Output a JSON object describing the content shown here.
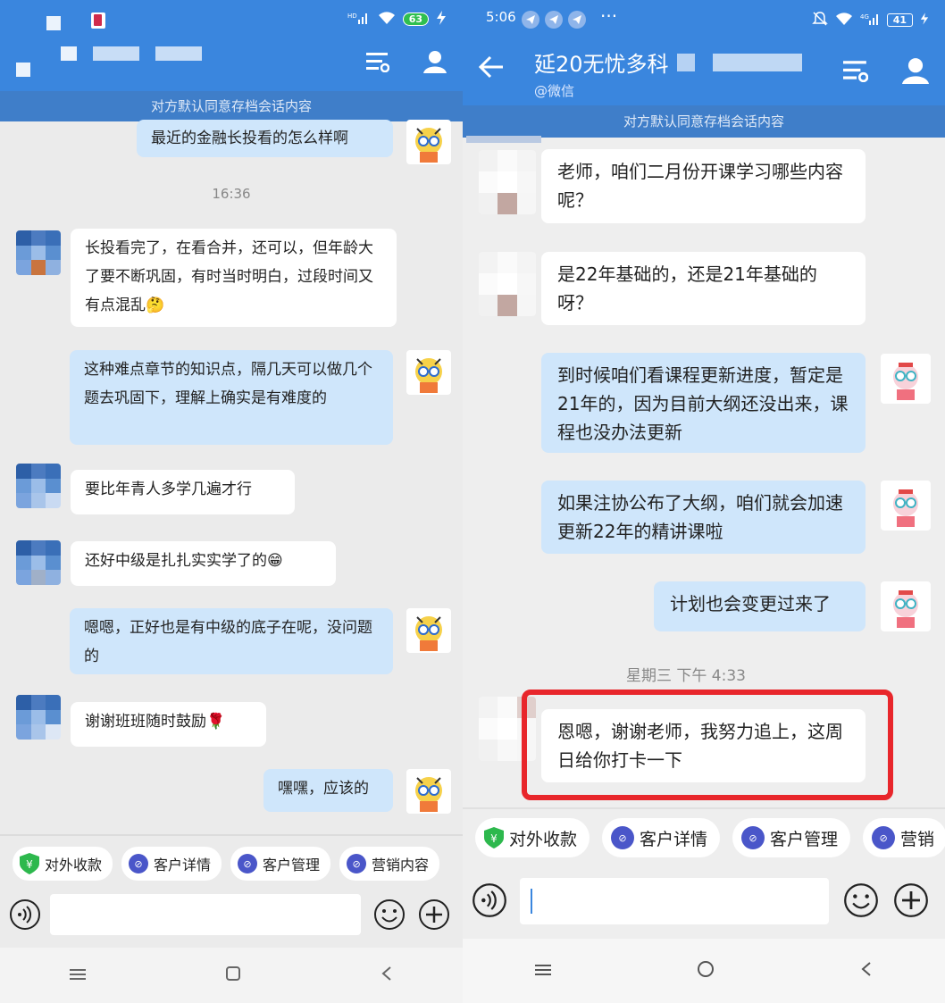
{
  "left": {
    "status": {
      "battery": "63"
    },
    "notice": "对方默认同意存档会话内容",
    "messages": [
      {
        "text": "最近的金融长投看的怎么样啊"
      },
      {
        "time": "16:36"
      },
      {
        "text": "长投看完了，在看合并，还可以，但年龄大了要不断巩固，有时当时明白，过段时间又有点混乱🤔"
      },
      {
        "text": "这种难点章节的知识点，隔几天可以做几个题去巩固下，理解上确实是有难度的"
      },
      {
        "text": "要比年青人多学几遍才行"
      },
      {
        "text": "还好中级是扎扎实实学了的😁"
      },
      {
        "text": "嗯嗯，正好也是有中级的底子在呢，没问题的"
      },
      {
        "text": "谢谢班班随时鼓励🌹"
      },
      {
        "text": "嘿嘿，应该的"
      }
    ],
    "quick_actions": [
      "对外收款",
      "客户详情",
      "客户管理",
      "营销内容"
    ]
  },
  "right": {
    "status": {
      "time": "5:06",
      "dots": "···",
      "battery": "41"
    },
    "title": "延20无忧多科",
    "subtitle": "@微信",
    "notice": "对方默认同意存档会话内容",
    "messages": [
      {
        "text": "老师，咱们二月份开课学习哪些内容呢？"
      },
      {
        "text": "是22年基础的，还是21年基础的呀？"
      },
      {
        "text": "到时候咱们看课程更新进度，暂定是21年的，因为目前大纲还没出来，课程也没办法更新"
      },
      {
        "text": "如果注协公布了大纲，咱们就会加速更新22年的精讲课啦"
      },
      {
        "text": "计划也会变更过来了"
      },
      {
        "time": "星期三  下午 4:33"
      },
      {
        "text": "恩嗯，谢谢老师，我努力追上，这周日给你打卡一下"
      }
    ],
    "quick_actions": [
      "对外收款",
      "客户详情",
      "客户管理",
      "营销"
    ]
  },
  "colors": {
    "header": "#3a86de",
    "out_bubble": "#cfe6fb",
    "highlight": "#e8262b",
    "chip_icon": "#4a56c9",
    "pay_icon": "#2db84d"
  }
}
